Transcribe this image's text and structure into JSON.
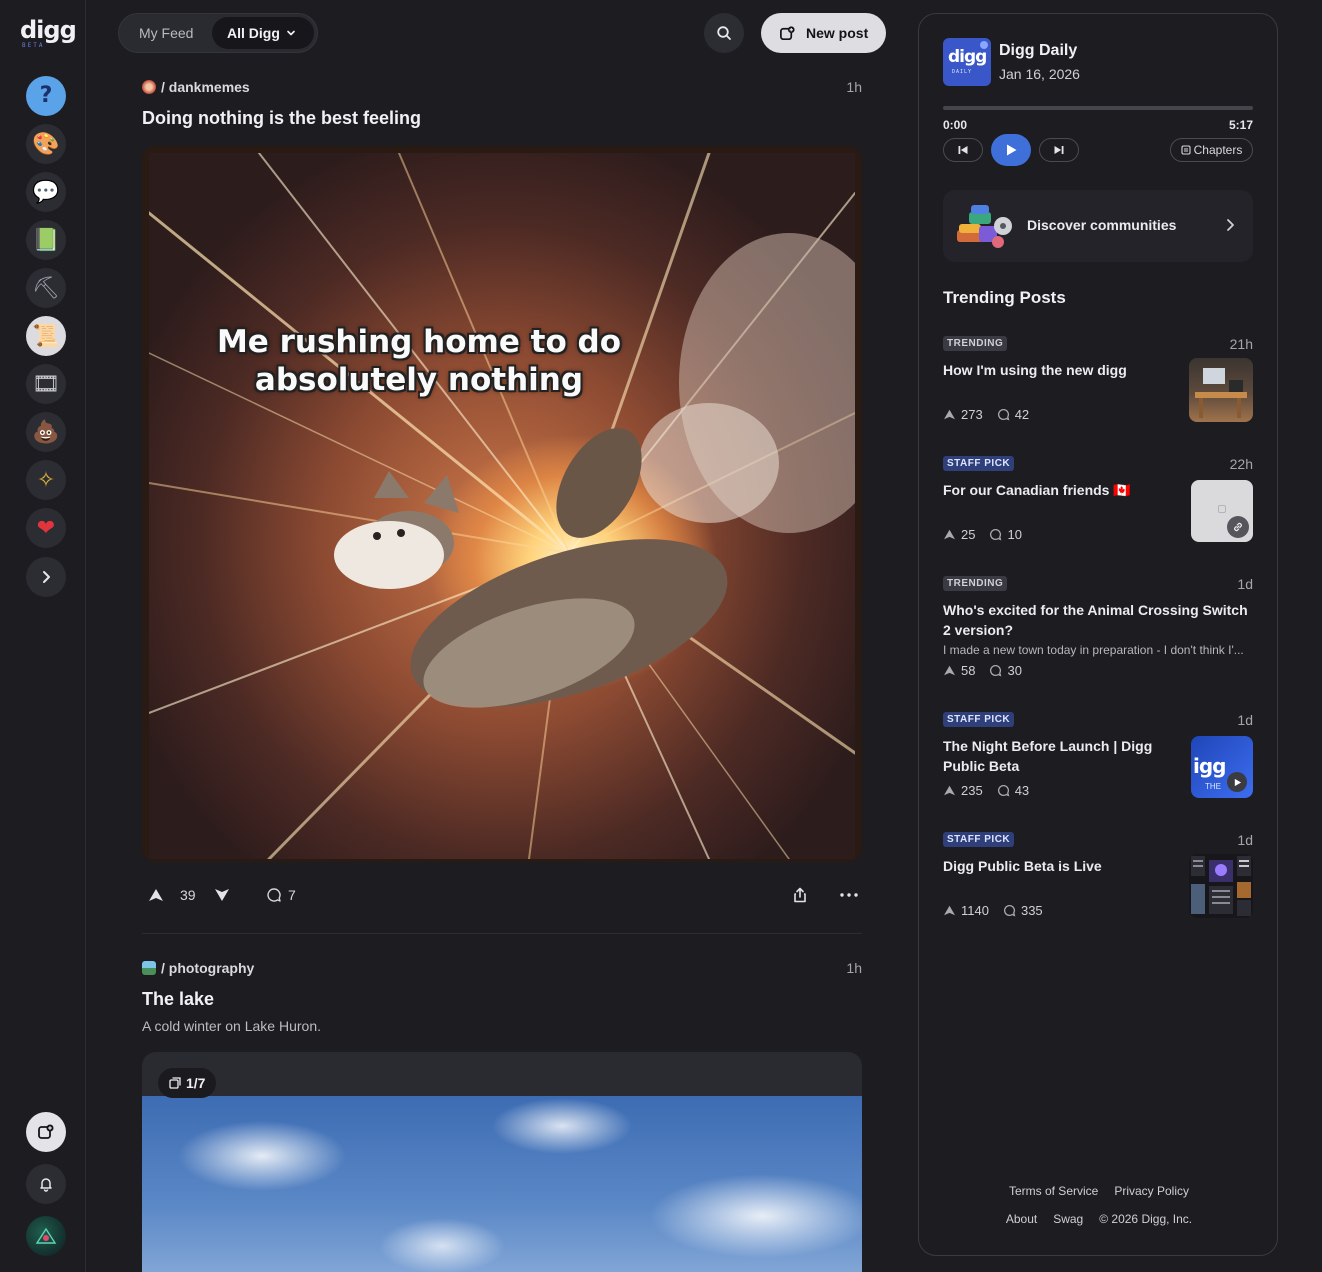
{
  "sidebar": {
    "logo_text": "digg",
    "logo_sub": "BETA",
    "communities": [
      {
        "icon": "question-icon",
        "glyph": "?"
      },
      {
        "icon": "palette-icon",
        "glyph": "🎨"
      },
      {
        "icon": "chat-bubbles-icon",
        "glyph": "💬"
      },
      {
        "icon": "book-icon",
        "glyph": "📗"
      },
      {
        "icon": "shovel-icon",
        "glyph": "⛏"
      },
      {
        "icon": "scroll-icon",
        "glyph": "📜"
      },
      {
        "icon": "film-reel-icon",
        "glyph": "🎞"
      },
      {
        "icon": "poop-icon",
        "glyph": "💩"
      },
      {
        "icon": "arrows-icon",
        "glyph": "✧"
      },
      {
        "icon": "heart-pulse-icon",
        "glyph": "❤"
      }
    ]
  },
  "header": {
    "my_feed": "My Feed",
    "all_digg": "All Digg",
    "new_post": "New post"
  },
  "posts": [
    {
      "community": "/ dankmemes",
      "time": "1h",
      "title": "Doing nothing is the best feeling",
      "caption": "Me rushing home to do absolutely nothing",
      "upvotes": "39",
      "comments": "7"
    },
    {
      "community": "/ photography",
      "time": "1h",
      "title": "The lake",
      "description": "A cold winter on Lake Huron.",
      "gallery": "1/7"
    }
  ],
  "podcast": {
    "title": "Digg Daily",
    "date": "Jan 16, 2026",
    "art_text": "digg",
    "art_sub": "DAILY",
    "current": "0:00",
    "duration": "5:17",
    "progress": 0,
    "chapters": "Chapters"
  },
  "discover": {
    "label": "Discover communities"
  },
  "trending": {
    "heading": "Trending Posts",
    "items": [
      {
        "badge": "TRENDING",
        "time": "21h",
        "title": "How I'm using the new digg",
        "upvotes": "273",
        "comments": "42"
      },
      {
        "badge": "STAFF PICK",
        "time": "22h",
        "title": "For our Canadian friends 🇨🇦",
        "upvotes": "25",
        "comments": "10"
      },
      {
        "badge": "TRENDING",
        "time": "1d",
        "title": "Who's excited for the Animal Crossing Switch 2 version?",
        "desc": "I made a new town today in preparation - I don't think I'...",
        "upvotes": "58",
        "comments": "30"
      },
      {
        "badge": "STAFF PICK",
        "time": "1d",
        "title": "The Night Before Launch | Digg Public Beta",
        "upvotes": "235",
        "comments": "43",
        "thumb_text": "igg",
        "thumb_sub": "THE"
      },
      {
        "badge": "STAFF PICK",
        "time": "1d",
        "title": "Digg Public Beta is Live",
        "upvotes": "1140",
        "comments": "335"
      }
    ]
  },
  "footer": {
    "terms": "Terms of Service",
    "privacy": "Privacy Policy",
    "about": "About",
    "swag": "Swag",
    "copyright": "© 2026 Digg, Inc."
  },
  "colors": {
    "accent": "#3f6fd9",
    "background": "#1c1c21",
    "staff_badge": "#2e3f7a"
  }
}
